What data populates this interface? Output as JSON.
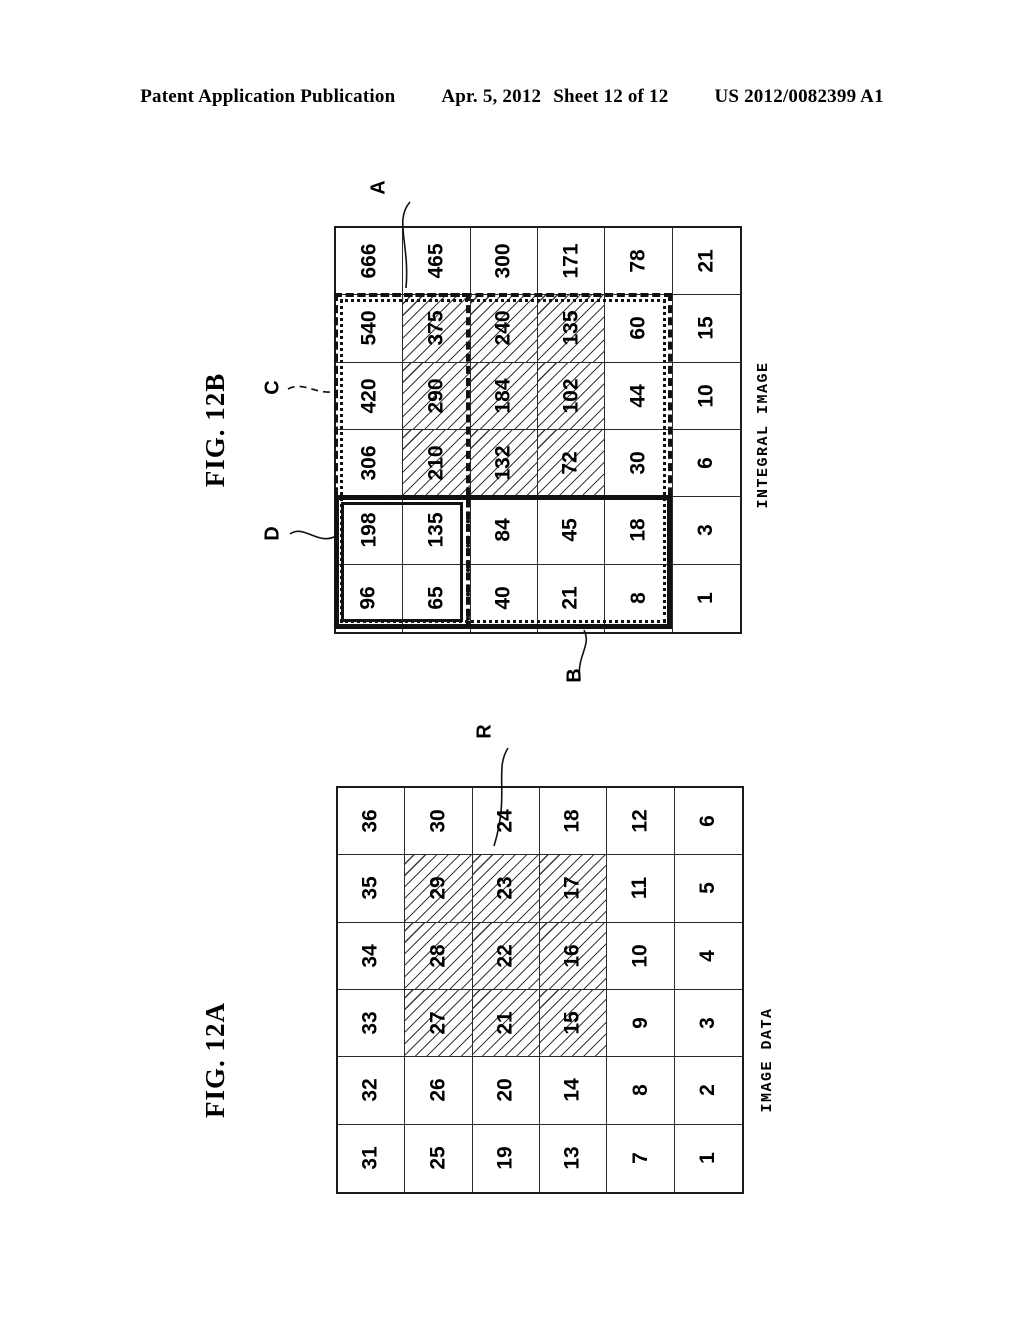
{
  "header": {
    "publication": "Patent Application Publication",
    "date": "Apr. 5, 2012",
    "sheet": "Sheet 12 of 12",
    "number": "US 2012/0082399 A1"
  },
  "figures": [
    {
      "id": "fig12a",
      "title": "FIG. 12A",
      "caption": "IMAGE DATA",
      "grid": {
        "rows": 6,
        "cols": 6,
        "values": [
          [
            1,
            2,
            3,
            4,
            5,
            6
          ],
          [
            7,
            8,
            9,
            10,
            11,
            12
          ],
          [
            13,
            14,
            15,
            16,
            17,
            18
          ],
          [
            19,
            20,
            21,
            22,
            23,
            24
          ],
          [
            25,
            26,
            27,
            28,
            29,
            30
          ],
          [
            31,
            32,
            33,
            34,
            35,
            36
          ]
        ],
        "hatched_cells": [
          [
            2,
            2
          ],
          [
            2,
            3
          ],
          [
            2,
            4
          ],
          [
            3,
            2
          ],
          [
            3,
            3
          ],
          [
            3,
            4
          ],
          [
            4,
            2
          ],
          [
            4,
            3
          ],
          [
            4,
            4
          ]
        ]
      },
      "callouts": [
        {
          "label": "R",
          "describes": "hatched-region-R"
        }
      ]
    },
    {
      "id": "fig12b",
      "title": "FIG. 12B",
      "caption": "INTEGRAL IMAGE",
      "grid": {
        "rows": 6,
        "cols": 6,
        "values": [
          [
            1,
            3,
            6,
            10,
            15,
            21
          ],
          [
            8,
            18,
            30,
            44,
            60,
            78
          ],
          [
            21,
            45,
            72,
            102,
            135,
            171
          ],
          [
            40,
            84,
            132,
            184,
            240,
            300
          ],
          [
            65,
            135,
            210,
            290,
            375,
            465
          ],
          [
            96,
            198,
            306,
            420,
            540,
            666
          ]
        ],
        "hatched_cells": [
          [
            2,
            2
          ],
          [
            2,
            3
          ],
          [
            2,
            4
          ],
          [
            3,
            2
          ],
          [
            3,
            3
          ],
          [
            3,
            4
          ],
          [
            4,
            2
          ],
          [
            4,
            3
          ],
          [
            4,
            4
          ]
        ]
      },
      "callouts": [
        {
          "label": "A",
          "describes": "region-A-dash-dot"
        },
        {
          "label": "B",
          "describes": "region-B-solid"
        },
        {
          "label": "C",
          "describes": "region-C-dashed"
        },
        {
          "label": "D",
          "describes": "region-D-double"
        }
      ]
    }
  ],
  "colors": {
    "ink": "#111111",
    "rule": "#2b2b2b",
    "hatch": "#3a3a3a",
    "paper": "#ffffff"
  }
}
